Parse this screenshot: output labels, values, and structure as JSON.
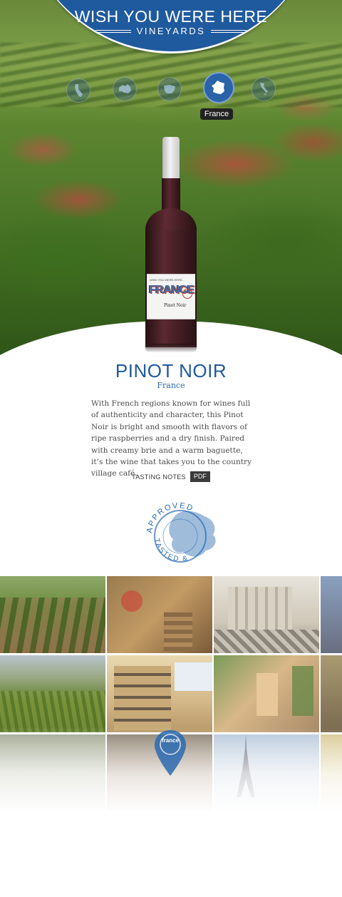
{
  "brand": {
    "title": "WISH YOU WERE HERE",
    "subtitle": "VINEYARDS",
    "color": "#1f5a9e"
  },
  "region_nav": {
    "items": [
      {
        "name": "california",
        "icon": "california-map-icon",
        "active": false
      },
      {
        "name": "australia",
        "icon": "australia-map-icon",
        "active": false
      },
      {
        "name": "spain",
        "icon": "spain-map-icon",
        "active": false
      },
      {
        "name": "france",
        "icon": "france-map-icon",
        "active": true
      },
      {
        "name": "italy",
        "icon": "italy-map-icon",
        "active": false
      }
    ],
    "active_label": "France"
  },
  "bottle_label": {
    "top_text": "WISH YOU WERE HERE...",
    "country": "FRANCE",
    "variety": "Pinot Noir"
  },
  "wine": {
    "name": "PINOT NOIR",
    "region": "France",
    "description": "With French regions known for wines full of authenticity and character, this Pinot Noir is bright and smooth with flavors of ripe raspberries and a dry finish. Paired with creamy brie and a warm baguette, it’s the wine that takes you to the country village café.",
    "tasting_notes_label": "TASTING NOTES",
    "pdf_label": "PDF"
  },
  "stamp": {
    "top_text": "APPROVED",
    "bottom_text": "TASTED &",
    "color": "#2a6ab0"
  },
  "photo_grid": {
    "pin_label": "france",
    "tiles": [
      {
        "name": "vineyard-rows"
      },
      {
        "name": "stone-stairway"
      },
      {
        "name": "palace-courtyard"
      },
      {
        "name": "paris-rooftops"
      },
      {
        "name": "vineyard-hills"
      },
      {
        "name": "hotel-facade"
      },
      {
        "name": "village-alley"
      },
      {
        "name": "cafe-street"
      },
      {
        "name": "garden-terrace"
      },
      {
        "name": "street-lamps"
      },
      {
        "name": "eiffel-tower"
      },
      {
        "name": "yellow-house"
      }
    ]
  }
}
